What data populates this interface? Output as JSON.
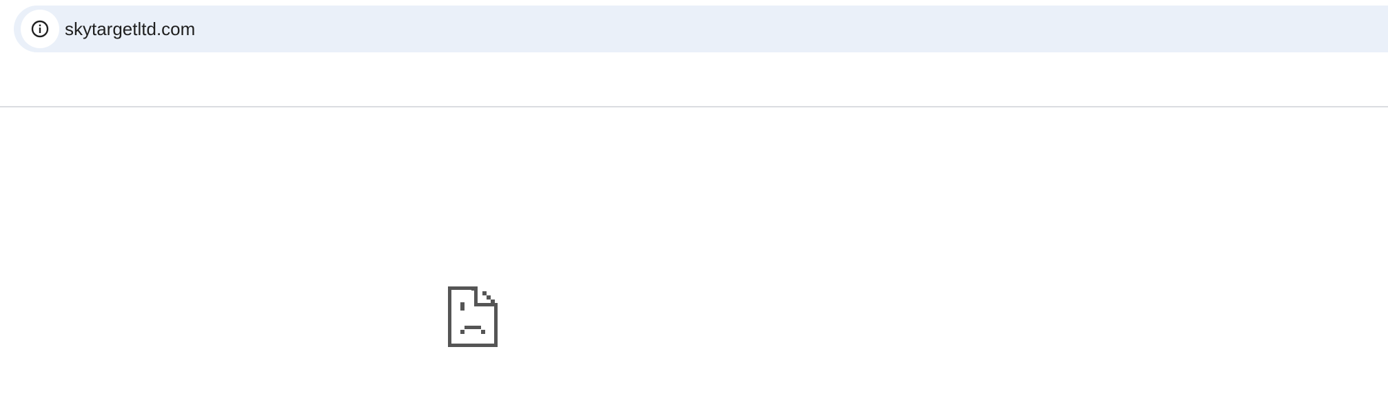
{
  "omnibox": {
    "url": "skytargetltd.com",
    "site_info_icon": "info-icon"
  },
  "content": {
    "error_icon": "sad-page-icon"
  },
  "colors": {
    "omnibox_background": "#eaf0f9",
    "icon_color": "#555555",
    "text_color": "#1f1f1f"
  }
}
